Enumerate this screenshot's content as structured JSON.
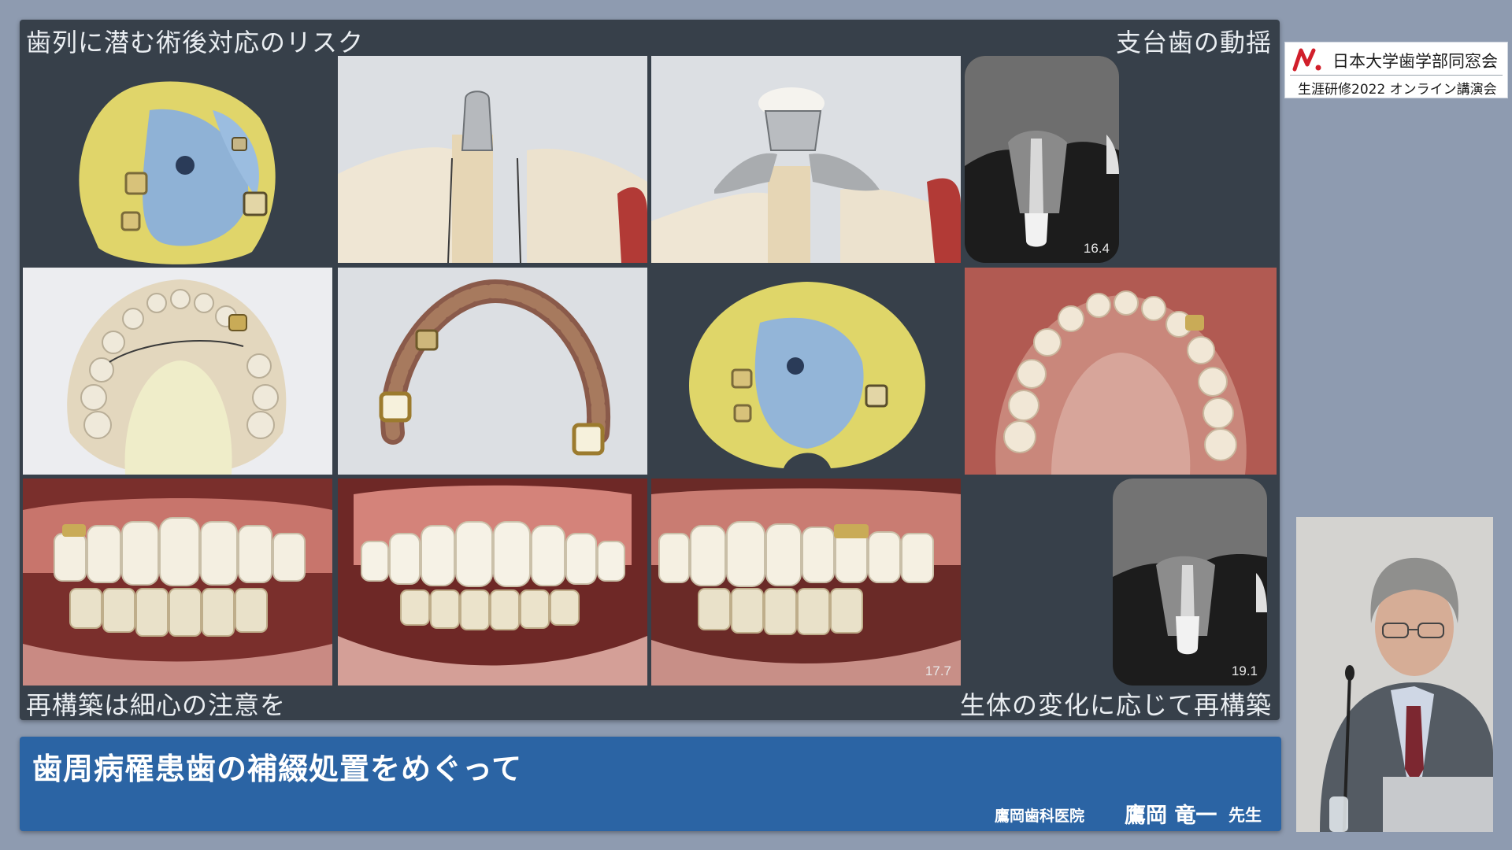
{
  "slide": {
    "caption_top_left": "歯列に潜む術後対応のリスク",
    "caption_top_right": "支台歯の動揺",
    "caption_bottom_left": "再構築は細心の注意を",
    "caption_bottom_right": "生体の変化に応じて再構築",
    "xray_label_1": "16.4",
    "photo_label_1": "17.7",
    "xray_label_2": "19.1"
  },
  "logo": {
    "mark": "N.",
    "organization": "日本大学歯学部同窓会",
    "subtitle": "生涯研修2022 オンライン講演会"
  },
  "titlebar": {
    "title": "歯周病罹患歯の補綴処置をめぐって",
    "clinic": "鷹岡歯科医院",
    "speaker": "鷹岡 竜一",
    "honorific": "先生"
  },
  "colors": {
    "background": "#8e9bb0",
    "slide_panel": "#37404a",
    "title_bar": "#2b64a4",
    "logo_accent": "#d11f2b"
  }
}
